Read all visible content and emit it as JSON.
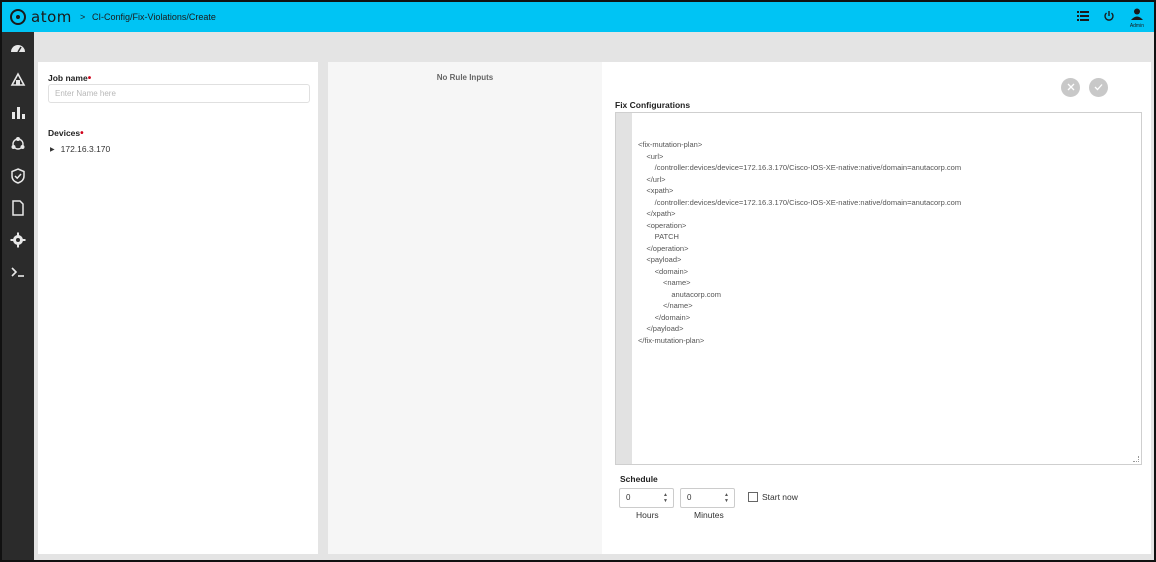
{
  "header": {
    "logo_text": "atom",
    "breadcrumb_sep": ">",
    "breadcrumb": "CI-Config/Fix-Violations/Create",
    "admin_label": "Admin",
    "accent_color": "#00c4f4"
  },
  "sidebar": {
    "items": [
      {
        "icon": "dashboard-icon"
      },
      {
        "icon": "devices-icon"
      },
      {
        "icon": "bar-chart-icon"
      },
      {
        "icon": "network-icon"
      },
      {
        "icon": "shield-icon"
      },
      {
        "icon": "document-icon"
      },
      {
        "icon": "gear-icon"
      },
      {
        "icon": "terminal-icon"
      }
    ]
  },
  "left_panel": {
    "job_name_label": "Job name",
    "job_name_placeholder": "Enter Name here",
    "job_name_value": "",
    "devices_label": "Devices",
    "devices": [
      "172.16.3.170"
    ]
  },
  "middle_panel": {
    "no_rule_text": "No Rule Inputs"
  },
  "right_panel": {
    "fix_config_label": "Fix Configurations",
    "code_lines": [
      "<fix-mutation-plan>",
      "    <url>",
      "        /controller:devices/device=172.16.3.170/Cisco-IOS-XE-native:native/domain=anutacorp.com",
      "    </url>",
      "    <xpath>",
      "        /controller:devices/device=172.16.3.170/Cisco-IOS-XE-native:native/domain=anutacorp.com",
      "    </xpath>",
      "    <operation>",
      "        PATCH",
      "    </operation>",
      "    <payload>",
      "        <domain>",
      "            <name>",
      "                anutacorp.com",
      "            </name>",
      "        </domain>",
      "    </payload>",
      "</fix-mutation-plan>"
    ],
    "schedule_label": "Schedule",
    "hours_value": "0",
    "minutes_value": "0",
    "hours_label": "Hours",
    "minutes_label": "Minutes",
    "start_now_label": "Start now",
    "close_icon": "close-icon",
    "check_icon": "check-icon"
  }
}
